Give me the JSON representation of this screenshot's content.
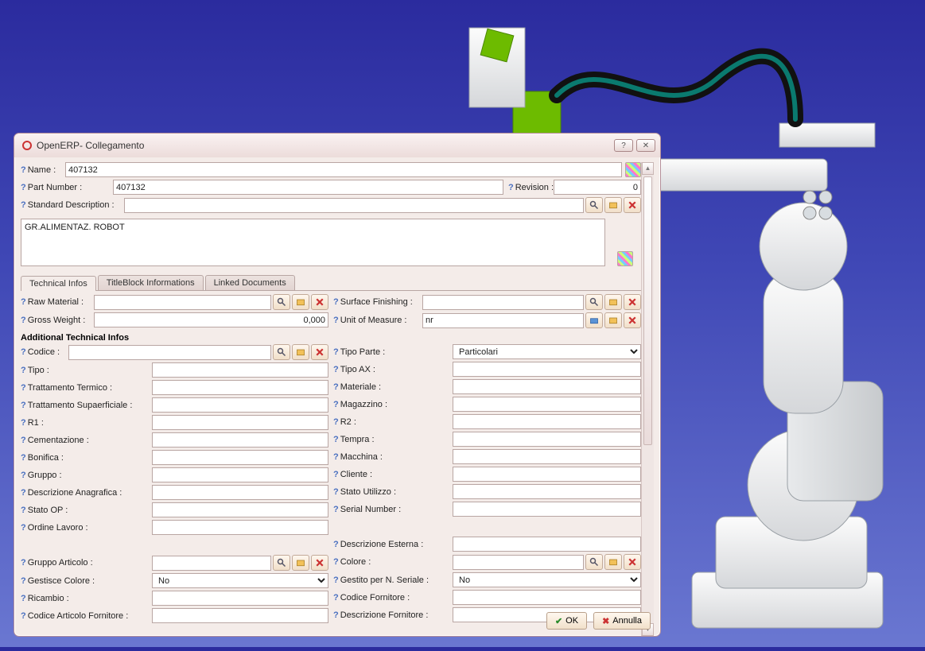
{
  "window": {
    "title": "OpenERP- Collegamento"
  },
  "header": {
    "name_lbl": "Name :",
    "name_val": "407132",
    "part_lbl": "Part Number :",
    "part_val": "407132",
    "rev_lbl": "Revision :",
    "rev_val": "0",
    "std_lbl": "Standard Description :",
    "desc_val": "GR.ALIMENTAZ. ROBOT"
  },
  "tabs": {
    "t1": "Technical Infos",
    "t2": "TitleBlock Informations",
    "t3": "Linked Documents"
  },
  "tech": {
    "raw_lbl": "Raw Material :",
    "surf_lbl": "Surface Finishing :",
    "gw_lbl": "Gross Weight :",
    "gw_val": "0,000",
    "uom_lbl": "Unit of Measure :",
    "uom_val": "nr",
    "add_title": "Additional Technical Infos",
    "codice_lbl": "Codice :",
    "tipoparte_lbl": "Tipo Parte :",
    "tipoparte_val": "Particolari",
    "tipo_lbl": "Tipo :",
    "tipoax_lbl": "Tipo AX :",
    "tratterm_lbl": "Trattamento Termico :",
    "materiale_lbl": "Materiale :",
    "trattsup_lbl": "Trattamento Supaerficiale :",
    "magazzino_lbl": "Magazzino :",
    "r1_lbl": "R1 :",
    "r2_lbl": "R2 :",
    "cement_lbl": "Cementazione :",
    "tempra_lbl": "Tempra :",
    "bonifica_lbl": "Bonifica :",
    "macchina_lbl": "Macchina :",
    "gruppo_lbl": "Gruppo :",
    "cliente_lbl": "Cliente :",
    "descanag_lbl": "Descrizione Anagrafica :",
    "stato_util_lbl": "Stato Utilizzo :",
    "statoop_lbl": "Stato OP :",
    "serial_lbl": "Serial Number :",
    "ordine_lbl": "Ordine Lavoro :",
    "descest_lbl": "Descrizione Esterna :",
    "gruppoart_lbl": "Gruppo Articolo :",
    "colore_lbl": "Colore :",
    "gestcol_lbl": "Gestisce Colore :",
    "gestcol_val": "No",
    "gestser_lbl": "Gestito per N. Seriale :",
    "gestser_val": "No",
    "ricambio_lbl": "Ricambio :",
    "codforn_lbl": "Codice Fornitore :",
    "codartforn_lbl": "Codice Articolo Fornitore :",
    "descforn_lbl": "Descrizione Fornitore :"
  },
  "buttons": {
    "ok": "OK",
    "cancel": "Annulla"
  }
}
